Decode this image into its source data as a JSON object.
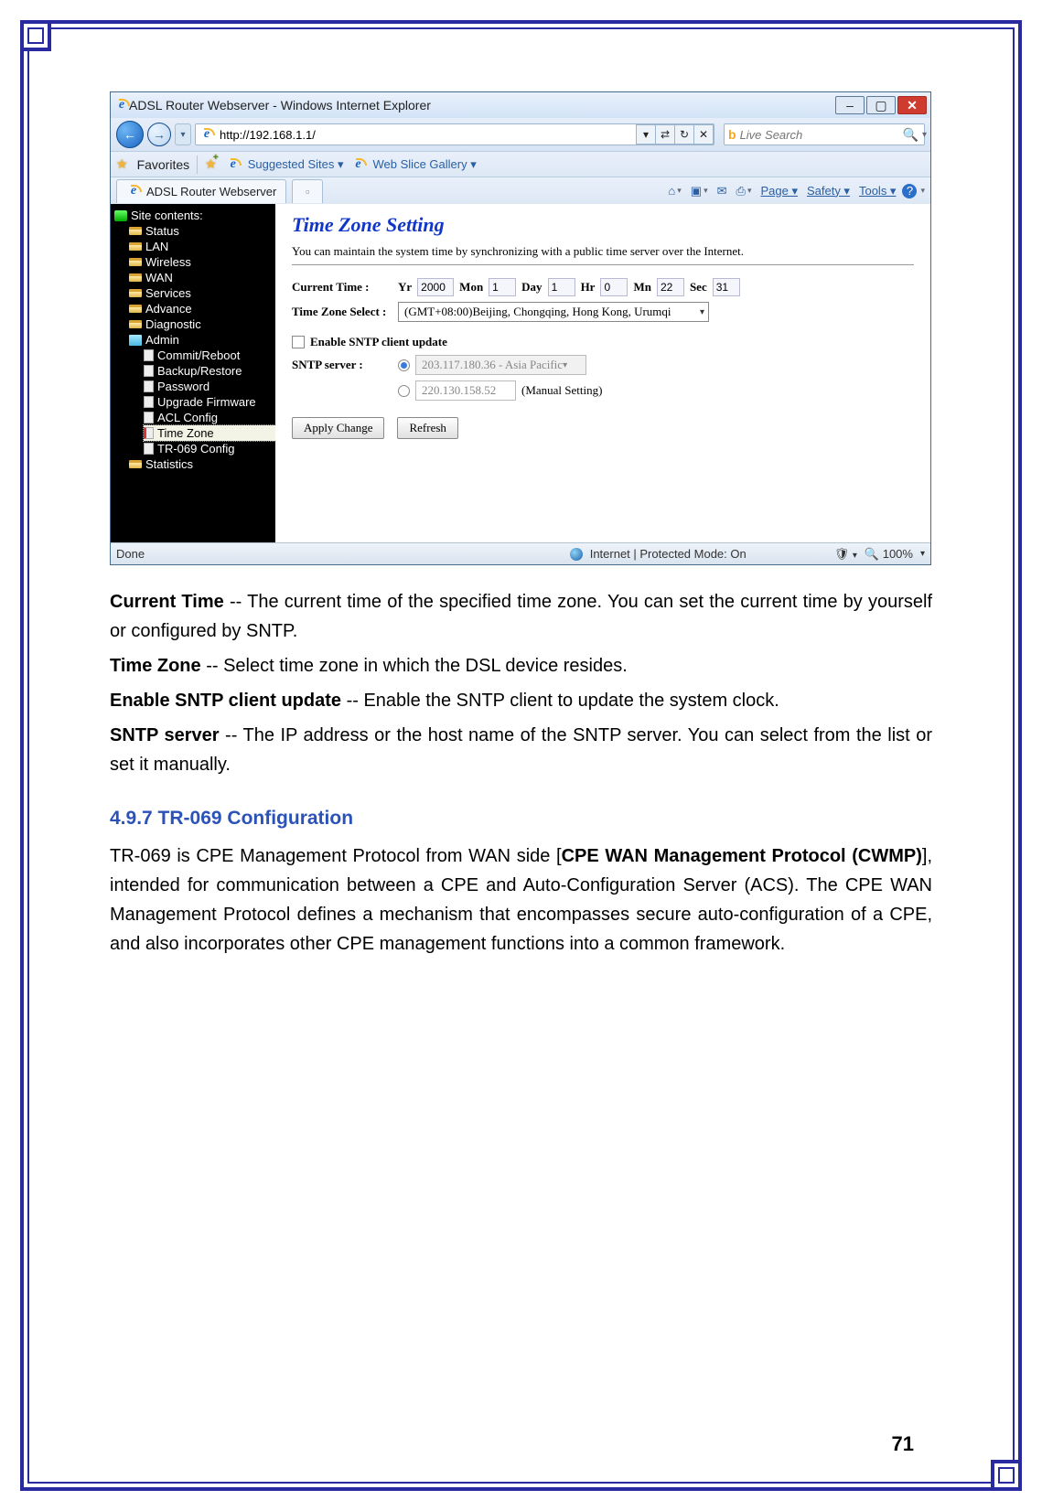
{
  "window": {
    "title": "ADSL Router Webserver - Windows Internet Explorer",
    "min": "–",
    "max": "▢",
    "close": "✕"
  },
  "nav": {
    "back_glyph": "←",
    "fwd_glyph": "→",
    "history_glyph": "▾",
    "url": "http://192.168.1.1/",
    "addr_glyph_drop": "▾",
    "addr_glyph_compat": "⇄",
    "addr_glyph_refresh": "↻",
    "addr_glyph_stop": "✕",
    "search_placeholder": "Live Search",
    "search_glyph": "🔍",
    "search_drop": "▾"
  },
  "fav": {
    "star": "★",
    "label": "Favorites",
    "add_star": "★",
    "suggested": "Suggested Sites ▾",
    "gallery": "Web Slice Gallery ▾"
  },
  "tab": {
    "title": "ADSL Router Webserver",
    "blank_glyph": "▫"
  },
  "cmd": {
    "home": "⌂",
    "feeds": "▣",
    "mail": "✉",
    "print": "⎙",
    "page": "Page ▾",
    "safety": "Safety ▾",
    "tools": "Tools ▾",
    "help": "?",
    "tri": "▾"
  },
  "sidebar": {
    "header": "Site contents:",
    "items": {
      "status": "Status",
      "lan": "LAN",
      "wireless": "Wireless",
      "wan": "WAN",
      "services": "Services",
      "advance": "Advance",
      "diagnostic": "Diagnostic",
      "admin": "Admin",
      "commit": "Commit/Reboot",
      "backup": "Backup/Restore",
      "password": "Password",
      "upgrade": "Upgrade Firmware",
      "acl": "ACL Config",
      "timezone": "Time Zone",
      "tr069": "TR-069 Config",
      "statistics": "Statistics"
    }
  },
  "main": {
    "heading": "Time Zone Setting",
    "desc": "You can maintain the system time by synchronizing with a public time server over the Internet.",
    "ct_label": "Current Time :",
    "yr_l": "Yr",
    "yr_v": "2000",
    "mon_l": "Mon",
    "mon_v": "1",
    "day_l": "Day",
    "day_v": "1",
    "hr_l": "Hr",
    "hr_v": "0",
    "mn_l": "Mn",
    "mn_v": "22",
    "sec_l": "Sec",
    "sec_v": "31",
    "tz_label": "Time Zone Select :",
    "tz_value": "(GMT+08:00)Beijing, Chongqing, Hong Kong, Urumqi",
    "enable_sntp": "Enable SNTP client update",
    "sntp_label": "SNTP server :",
    "sntp_opt1": "203.117.180.36 - Asia Pacific",
    "sntp_opt2": "220.130.158.52",
    "manual": "(Manual Setting)",
    "apply": "Apply Change",
    "refresh": "Refresh"
  },
  "status": {
    "done": "Done",
    "mode": "Internet | Protected Mode: On",
    "zoom": "100%",
    "zoom_glyph": "🔍",
    "shield": "🛡",
    "tri": "▾"
  },
  "doc": {
    "p1a": "Current Time",
    "p1b": " -- The current time of the specified time zone. You can set the current time by yourself or configured by SNTP.",
    "p2a": "Time Zone",
    "p2b": " -- Select time zone in which the DSL device resides.",
    "p3a": "Enable SNTP client update",
    "p3b": " -- Enable the SNTP client to update the system clock.",
    "p4a": "SNTP server",
    "p4b": " -- The IP address or the host name of the SNTP server. You can select from the list or set it manually.",
    "h3": "4.9.7 TR-069 Configuration",
    "p5a": "TR-069 is CPE Management Protocol from WAN side [",
    "p5b": "CPE WAN Management Protocol (CWMP)",
    "p5c": "], intended for communication between a CPE and Auto-Configuration Server (ACS). The CPE WAN Management Protocol defines a mechanism that encompasses secure auto-configuration of a CPE, and also incorporates other CPE management functions into a common framework."
  },
  "pagenum": "71"
}
